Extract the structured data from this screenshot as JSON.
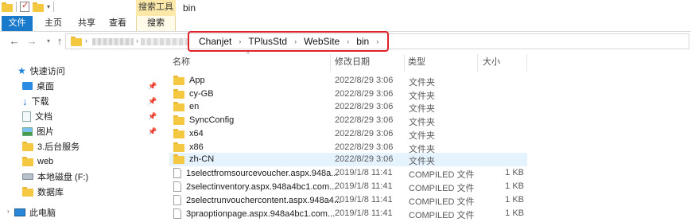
{
  "window": {
    "title": "bin",
    "context_tab_header": "搜索工具"
  },
  "ribbon": {
    "tabs": [
      "文件",
      "主页",
      "共享",
      "查看",
      "搜索"
    ]
  },
  "address": {
    "crumbs": [
      "Chanjet",
      "TPlusStd",
      "WebSite",
      "bin"
    ],
    "highlight_color": "#e0232a"
  },
  "columns": {
    "name": "名称",
    "date": "修改日期",
    "type": "类型",
    "size": "大小"
  },
  "nav": {
    "items": [
      {
        "label": "快速访问",
        "icon": "star-icon",
        "pinned": false
      },
      {
        "label": "桌面",
        "icon": "desktop-icon",
        "pinned": true
      },
      {
        "label": "下载",
        "icon": "download-icon",
        "pinned": true
      },
      {
        "label": "文档",
        "icon": "document-icon",
        "pinned": true
      },
      {
        "label": "图片",
        "icon": "picture-icon",
        "pinned": true
      },
      {
        "label": "3.后台服务",
        "icon": "folder-icon",
        "pinned": false
      },
      {
        "label": "web",
        "icon": "folder-icon",
        "pinned": false
      },
      {
        "label": "本地磁盘 (F:)",
        "icon": "drive-icon",
        "pinned": false
      },
      {
        "label": "数据库",
        "icon": "folder-icon",
        "pinned": false
      },
      {
        "label": "此电脑",
        "icon": "computer-icon",
        "pinned": false
      }
    ]
  },
  "files": [
    {
      "name": "App",
      "date": "2022/8/29 3:06",
      "type": "文件夹",
      "size": "",
      "kind": "folder"
    },
    {
      "name": "cy-GB",
      "date": "2022/8/29 3:06",
      "type": "文件夹",
      "size": "",
      "kind": "folder"
    },
    {
      "name": "en",
      "date": "2022/8/29 3:06",
      "type": "文件夹",
      "size": "",
      "kind": "folder"
    },
    {
      "name": "SyncConfig",
      "date": "2022/8/29 3:06",
      "type": "文件夹",
      "size": "",
      "kind": "folder"
    },
    {
      "name": "x64",
      "date": "2022/8/29 3:06",
      "type": "文件夹",
      "size": "",
      "kind": "folder"
    },
    {
      "name": "x86",
      "date": "2022/8/29 3:06",
      "type": "文件夹",
      "size": "",
      "kind": "folder"
    },
    {
      "name": "zh-CN",
      "date": "2022/8/29 3:06",
      "type": "文件夹",
      "size": "",
      "kind": "folder",
      "selected": true
    },
    {
      "name": "1selectfromsourcevoucher.aspx.948a...",
      "date": "2019/1/8 11:41",
      "type": "COMPILED 文件",
      "size": "1 KB",
      "kind": "file"
    },
    {
      "name": "2selectinventory.aspx.948a4bc1.com...",
      "date": "2019/1/8 11:41",
      "type": "COMPILED 文件",
      "size": "1 KB",
      "kind": "file"
    },
    {
      "name": "2selectrunvouchercontent.aspx.948a4...",
      "date": "2019/1/8 11:41",
      "type": "COMPILED 文件",
      "size": "1 KB",
      "kind": "file"
    },
    {
      "name": "3praoptionpage.aspx.948a4bc1.com...",
      "date": "2019/1/8 11:41",
      "type": "COMPILED 文件",
      "size": "1 KB",
      "kind": "file"
    }
  ]
}
